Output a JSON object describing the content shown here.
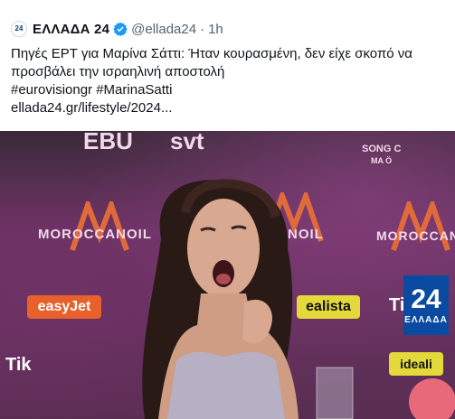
{
  "tweet": {
    "avatar_text": "24",
    "display_name": "ΕΛΛΑΔΑ 24",
    "handle": "@ellada24",
    "separator": "·",
    "time": "1h",
    "lines": [
      "Πηγές ΕΡΤ για Μαρίνα Σάττι: Ήταν κουρασμένη, δεν είχε σκοπό να",
      "προσβάλει την ισραηλινή αποστολή",
      "#eurovisiongr #MarinaSatti",
      "ellada24.gr/lifestyle/2024..."
    ],
    "colors": {
      "text": "#0f1419",
      "secondary": "#536471",
      "verified": "#1d9bf0"
    }
  },
  "media": {
    "top_logos": {
      "ebu": "EBU",
      "svt": "svt",
      "song_contest": "SONG C",
      "malmo": "MA  Ö"
    },
    "moroccanoil_left": "MOROCCANOIL",
    "moroccanoil_right": "MOROCCANOIL",
    "moroccanoil_center": "NOIL",
    "easyjet": "easyJet",
    "realista": "ealista",
    "idealista": "ideali",
    "tiktok_right": "TikT",
    "tiktok_left": "Tik",
    "watermark": {
      "number": "24",
      "label": "ΕΛΛΑΔΑ"
    }
  }
}
